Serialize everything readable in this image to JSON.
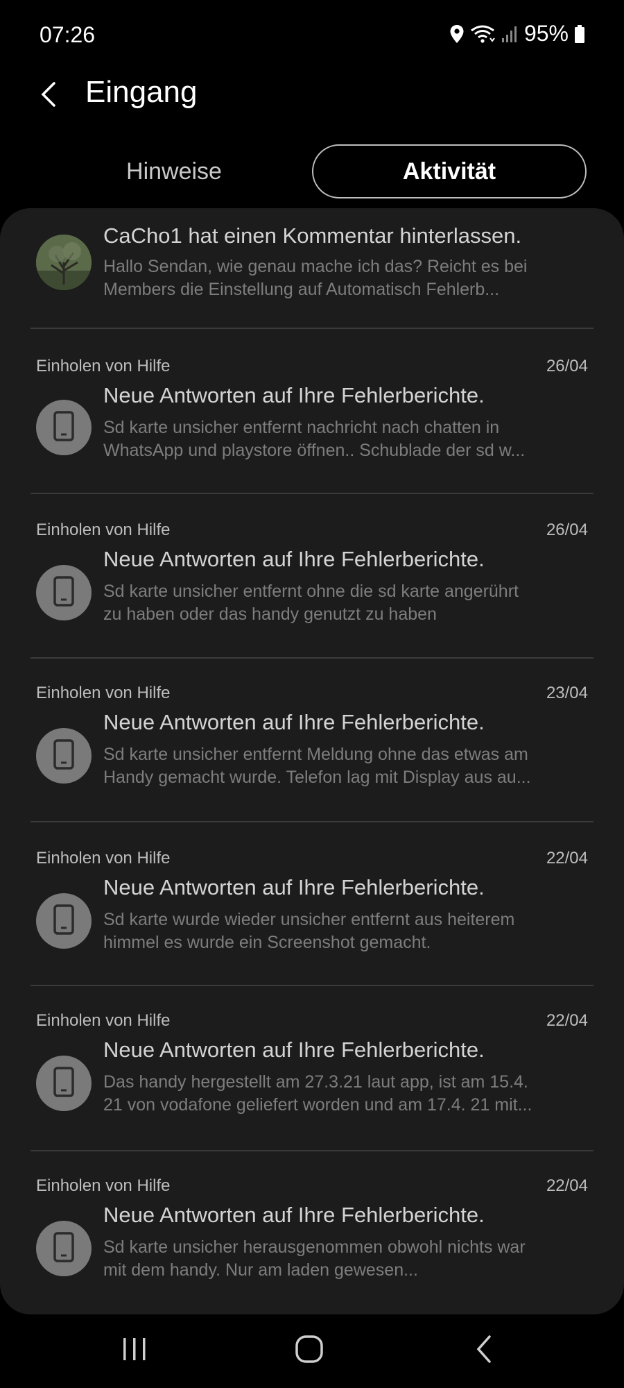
{
  "status_bar": {
    "time": "07:26",
    "battery": "95%",
    "icons": [
      "location-icon",
      "wifi-icon",
      "signal-icon",
      "battery-icon"
    ]
  },
  "header": {
    "back_icon": "chevron-left-icon",
    "title": "Eingang"
  },
  "tabs": [
    {
      "label": "Hinweise",
      "selected": false
    },
    {
      "label": "Aktivität",
      "selected": true
    }
  ],
  "activity": {
    "first_item": {
      "title": "CaCho1 hat einen Kommentar hinterlassen.",
      "body_line1": "Hallo Sendan, wie genau mache ich das? Reicht es bei",
      "body_line2": "Members die Einstellung auf Automatisch Fehlerb..."
    },
    "items": [
      {
        "category": "Einholen von Hilfe",
        "date": "26/04",
        "title": "Neue Antworten auf Ihre Fehlerberichte.",
        "body_line1": "Sd karte unsicher entfernt nachricht nach chatten in",
        "body_line2": "WhatsApp und playstore öffnen.. Schublade der sd w..."
      },
      {
        "category": "Einholen von Hilfe",
        "date": "26/04",
        "title": "Neue Antworten auf Ihre Fehlerberichte.",
        "body_line1": "Sd karte unsicher entfernt ohne die sd karte angerührt",
        "body_line2": "zu haben oder das handy genutzt zu haben"
      },
      {
        "category": "Einholen von Hilfe",
        "date": "23/04",
        "title": "Neue Antworten auf Ihre Fehlerberichte.",
        "body_line1": "Sd karte unsicher entfernt Meldung ohne das etwas am",
        "body_line2": "Handy gemacht wurde. Telefon lag mit Display aus au..."
      },
      {
        "category": "Einholen von Hilfe",
        "date": "22/04",
        "title": "Neue Antworten auf Ihre Fehlerberichte.",
        "body_line1": "Sd karte wurde wieder unsicher entfernt aus heiterem",
        "body_line2": "himmel es wurde ein Screenshot gemacht."
      },
      {
        "category": "Einholen von Hilfe",
        "date": "22/04",
        "title": "Neue Antworten auf Ihre Fehlerberichte.",
        "body_line1": "Das handy hergestellt am 27.3.21 laut app, ist am 15.4.",
        "body_line2": "21 von vodafone geliefert worden und am 17.4. 21 mit..."
      },
      {
        "category": "Einholen von Hilfe",
        "date": "22/04",
        "title": "Neue Antworten auf Ihre Fehlerberichte.",
        "body_line1": "Sd karte unsicher herausgenommen obwohl nichts war",
        "body_line2": "mit dem handy. Nur am laden gewesen..."
      }
    ]
  },
  "nav_bar": {
    "icons": [
      "recents-icon",
      "home-icon",
      "back-icon"
    ]
  },
  "colors": {
    "background": "#000000",
    "panel": "#1c1c1c",
    "divider": "#3b3b3b",
    "avatar": "#7a7a7a"
  }
}
